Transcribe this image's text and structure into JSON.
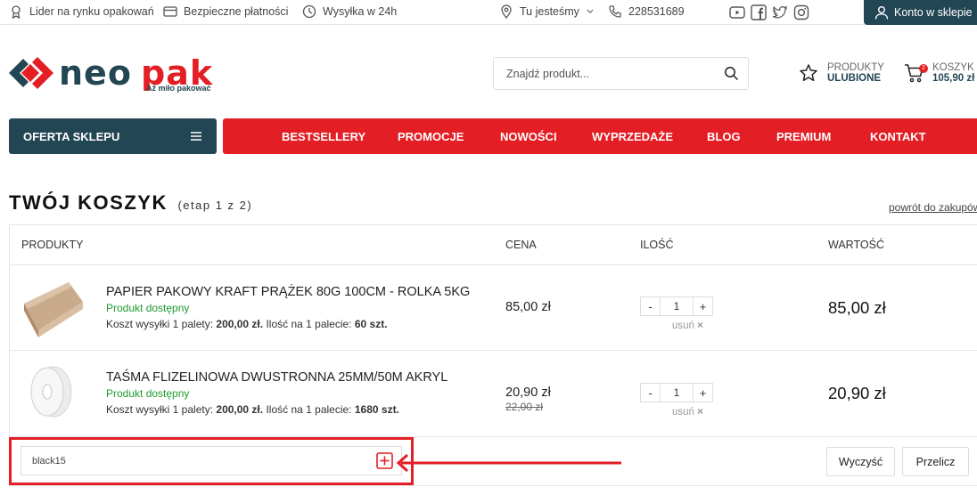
{
  "topbar": {
    "leader": "Lider na rynku opakowań",
    "payments": "Bezpieczne płatności",
    "shipping": "Wysyłka w 24h",
    "location": "Tu jesteśmy",
    "phone": "228531689",
    "account": "Konto w sklepie"
  },
  "header": {
    "logo_text": "neopak",
    "logo_tagline": "Aż miło pakować",
    "search_placeholder": "Znajdź produkt...",
    "favorites_line1": "PRODUKTY",
    "favorites_line2": "ULUBIONE",
    "cart_line1": "KOSZYK",
    "cart_total": "105,90 zł",
    "cart_count": "2"
  },
  "nav": {
    "offer": "OFERTA SKLEPU",
    "items": [
      "BESTSELLERY",
      "PROMOCJE",
      "NOWOŚCI",
      "WYPRZEDAŻE",
      "BLOG",
      "PREMIUM",
      "KONTAKT"
    ]
  },
  "page": {
    "title": "TWÓJ KOSZYK",
    "step": "(etap 1 z 2)",
    "back_link": "powrót do zakupów"
  },
  "table": {
    "headers": [
      "PRODUKTY",
      "CENA",
      "ILOŚĆ",
      "WARTOŚĆ"
    ],
    "rows": [
      {
        "name": "PAPIER PAKOWY KRAFT PRĄŻEK 80G 100CM - ROLKA 5KG",
        "availability": "Produkt dostępny",
        "ship_prefix": "Koszt wysyłki 1 palety:",
        "ship_cost": "200,00 zł.",
        "pallet_prefix": "Ilość na 1 palecie:",
        "pallet_qty": "60 szt.",
        "price": "85,00 zł",
        "old_price": "",
        "qty": "1",
        "remove": "usuń",
        "total": "85,00 zł"
      },
      {
        "name": "TAŚMA FLIZELINOWA DWUSTRONNA 25MM/50M AKRYL",
        "availability": "Produkt dostępny",
        "ship_prefix": "Koszt wysyłki 1 palety:",
        "ship_cost": "200,00 zł.",
        "pallet_prefix": "Ilość na 1 palecie:",
        "pallet_qty": "1680 szt.",
        "price": "20,90 zł",
        "old_price": "22,00 zł",
        "qty": "1",
        "remove": "usuń",
        "total": "20,90 zł"
      }
    ]
  },
  "coupon": {
    "value": "black15",
    "minus": "-",
    "plus": "+",
    "remove_x": "×"
  },
  "actions": {
    "clear": "Wyczyść",
    "recalc": "Przelicz"
  },
  "colors": {
    "brand_dark": "#234654",
    "brand_red": "#e31e24",
    "available_green": "#1e9a2f"
  }
}
